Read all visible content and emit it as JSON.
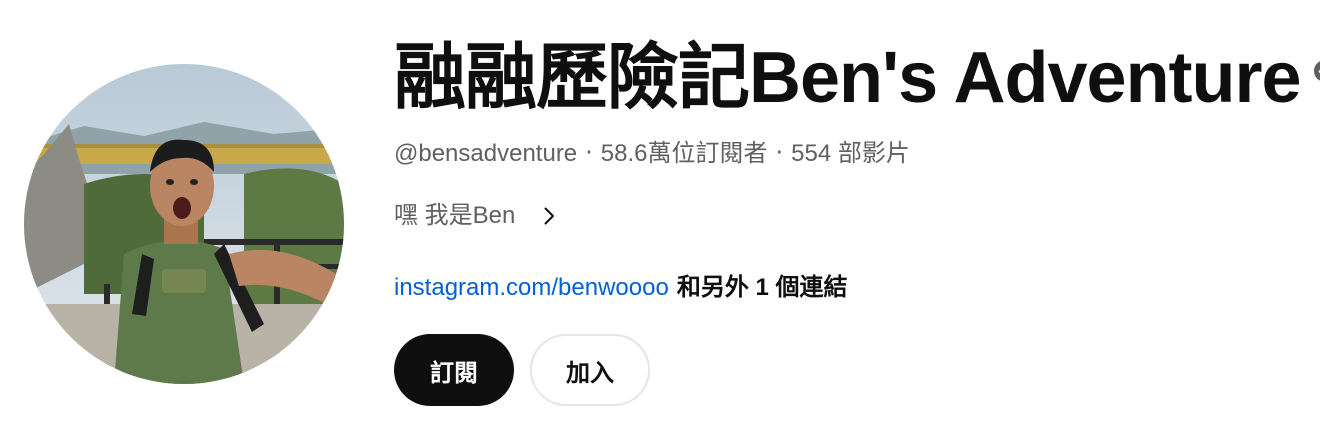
{
  "channel": {
    "title": "融融歷險記Ben's Adventure",
    "verified_icon": "verified-check-icon",
    "handle": "@bensadventure",
    "separator": "‧",
    "subscribers": "58.6萬位訂閱者",
    "videos": "554 部影片",
    "description": "嘿 我是Ben",
    "description_expand_icon": "chevron-right-icon",
    "link": "instagram.com/benwoooo",
    "more_links": "和另外 1 個連結"
  },
  "buttons": {
    "subscribe_label": "訂閱",
    "join_label": "加入"
  },
  "colors": {
    "text_primary": "#0f0f0f",
    "text_secondary": "#606060",
    "link": "#065fd4",
    "subscribe_bg": "#0f0f0f",
    "join_border": "#e5e5e5"
  }
}
